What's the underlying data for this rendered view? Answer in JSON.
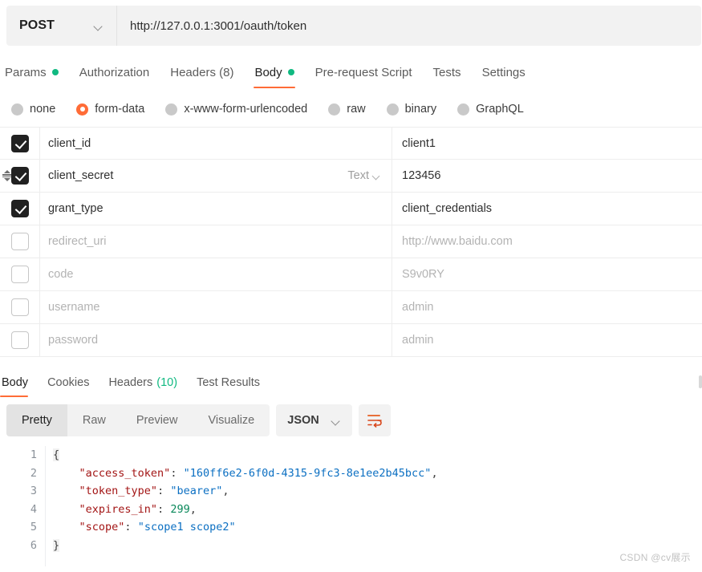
{
  "request": {
    "method": "POST",
    "method_icon": "chevron-down-icon",
    "url": "http://127.0.0.1:3001/oauth/token",
    "tabs": [
      {
        "label": "Params",
        "badge_dot": true,
        "active": false
      },
      {
        "label": "Authorization",
        "badge_dot": false,
        "active": false
      },
      {
        "label": "Headers (8)",
        "badge_dot": false,
        "active": false
      },
      {
        "label": "Body",
        "badge_dot": true,
        "active": true
      },
      {
        "label": "Pre-request Script",
        "badge_dot": false,
        "active": false
      },
      {
        "label": "Tests",
        "badge_dot": false,
        "active": false
      },
      {
        "label": "Settings",
        "badge_dot": false,
        "active": false
      }
    ],
    "body_types": [
      {
        "label": "none",
        "selected": false
      },
      {
        "label": "form-data",
        "selected": true
      },
      {
        "label": "x-www-form-urlencoded",
        "selected": false
      },
      {
        "label": "raw",
        "selected": false
      },
      {
        "label": "binary",
        "selected": false
      },
      {
        "label": "GraphQL",
        "selected": false
      }
    ],
    "form_rows": [
      {
        "checked": true,
        "key": "client_id",
        "value": "client1",
        "type": null,
        "drag": false
      },
      {
        "checked": true,
        "key": "client_secret",
        "value": "123456",
        "type": "Text",
        "drag": true
      },
      {
        "checked": true,
        "key": "grant_type",
        "value": "client_credentials",
        "type": null,
        "drag": false
      },
      {
        "checked": false,
        "key": "redirect_uri",
        "value": "http://www.baidu.com",
        "type": null,
        "drag": false
      },
      {
        "checked": false,
        "key": "code",
        "value": "S9v0RY",
        "type": null,
        "drag": false
      },
      {
        "checked": false,
        "key": "username",
        "value": "admin",
        "type": null,
        "drag": false
      },
      {
        "checked": false,
        "key": "password",
        "value": "admin",
        "type": null,
        "drag": false
      }
    ]
  },
  "response": {
    "tabs": [
      {
        "label": "Body",
        "count": "",
        "active": true
      },
      {
        "label": "Cookies",
        "count": "",
        "active": false
      },
      {
        "label": "Headers",
        "count": "(10)",
        "active": false
      },
      {
        "label": "Test Results",
        "count": "",
        "active": false
      }
    ],
    "view_modes": [
      {
        "label": "Pretty",
        "active": true
      },
      {
        "label": "Raw",
        "active": false
      },
      {
        "label": "Preview",
        "active": false
      },
      {
        "label": "Visualize",
        "active": false
      }
    ],
    "format": "JSON",
    "format_icon": "chevron-down-icon",
    "wrap_icon": "wrap-lines-icon",
    "code_lines": [
      {
        "num": "1",
        "tokens": [
          {
            "t": "brace",
            "v": "{"
          }
        ]
      },
      {
        "num": "2",
        "tokens": [
          {
            "t": "p",
            "v": "    "
          },
          {
            "t": "k",
            "v": "\"access_token\""
          },
          {
            "t": "p",
            "v": ": "
          },
          {
            "t": "s",
            "v": "\"160ff6e2-6f0d-4315-9fc3-8e1ee2b45bcc\""
          },
          {
            "t": "p",
            "v": ","
          }
        ]
      },
      {
        "num": "3",
        "tokens": [
          {
            "t": "p",
            "v": "    "
          },
          {
            "t": "k",
            "v": "\"token_type\""
          },
          {
            "t": "p",
            "v": ": "
          },
          {
            "t": "s",
            "v": "\"bearer\""
          },
          {
            "t": "p",
            "v": ","
          }
        ]
      },
      {
        "num": "4",
        "tokens": [
          {
            "t": "p",
            "v": "    "
          },
          {
            "t": "k",
            "v": "\"expires_in\""
          },
          {
            "t": "p",
            "v": ": "
          },
          {
            "t": "n",
            "v": "299"
          },
          {
            "t": "p",
            "v": ","
          }
        ]
      },
      {
        "num": "5",
        "tokens": [
          {
            "t": "p",
            "v": "    "
          },
          {
            "t": "k",
            "v": "\"scope\""
          },
          {
            "t": "p",
            "v": ": "
          },
          {
            "t": "s",
            "v": "\"scope1 scope2\""
          }
        ]
      },
      {
        "num": "6",
        "tokens": [
          {
            "t": "brace",
            "v": "}"
          }
        ]
      }
    ]
  },
  "watermark": "CSDN @cv展示",
  "colors": {
    "accent": "#ff6c37",
    "green": "#10b981",
    "key": "#a31515",
    "string": "#0b6fc2",
    "number": "#09885a"
  }
}
